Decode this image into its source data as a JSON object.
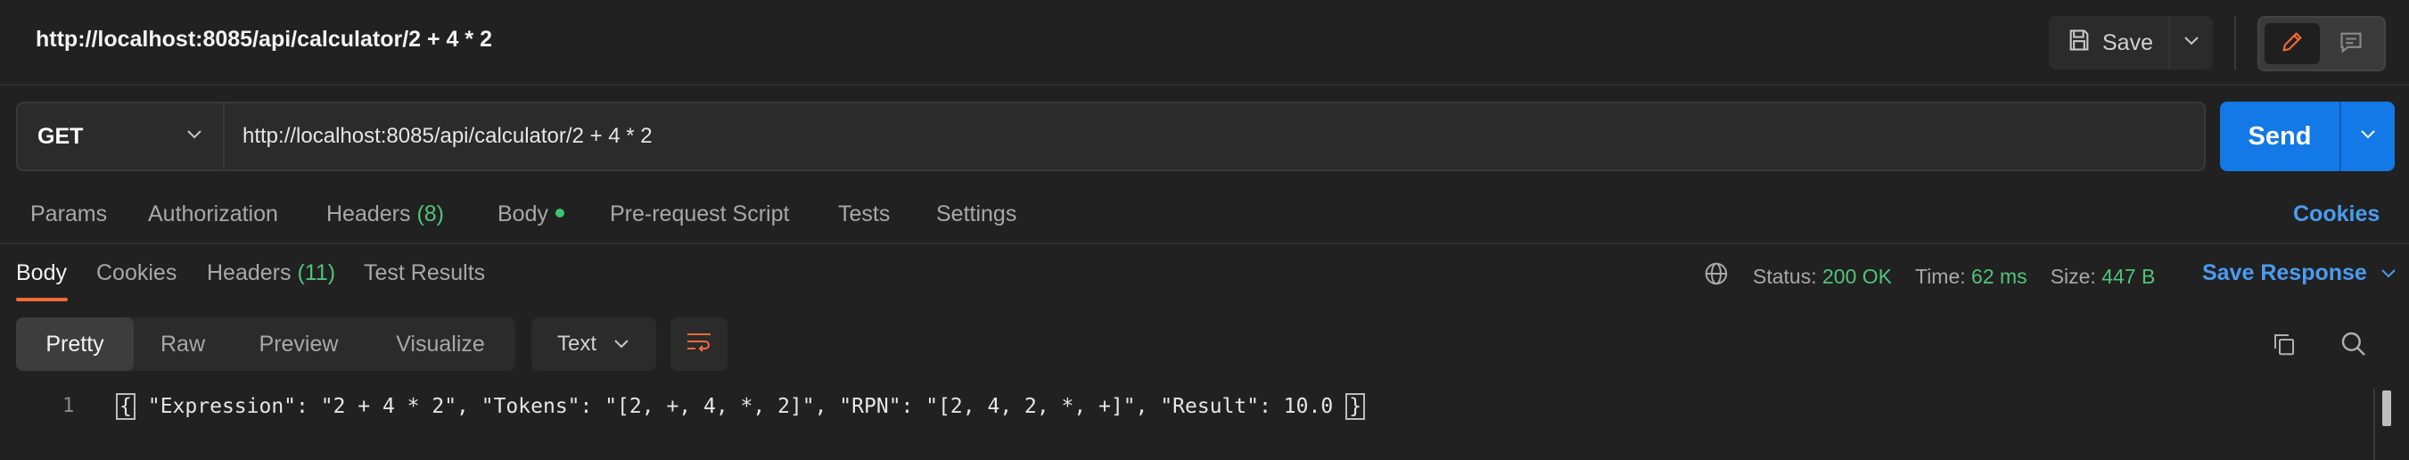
{
  "header": {
    "title": "http://localhost:8085/api/calculator/2 + 4 * 2",
    "save_label": "Save"
  },
  "request": {
    "method": "GET",
    "url": "http://localhost:8085/api/calculator/2 + 4 * 2",
    "send_label": "Send"
  },
  "request_tabs": {
    "params": "Params",
    "authorization": "Authorization",
    "headers": "Headers",
    "headers_count": "(8)",
    "body": "Body",
    "pre_request": "Pre-request Script",
    "tests": "Tests",
    "settings": "Settings",
    "cookies": "Cookies"
  },
  "response_tabs": {
    "body": "Body",
    "cookies": "Cookies",
    "headers": "Headers",
    "headers_count": "(11)",
    "test_results": "Test Results"
  },
  "status": {
    "status_label": "Status:",
    "status_value": "200 OK",
    "time_label": "Time:",
    "time_value": "62 ms",
    "size_label": "Size:",
    "size_value": "447 B",
    "save_response": "Save Response"
  },
  "view_modes": {
    "pretty": "Pretty",
    "raw": "Raw",
    "preview": "Preview",
    "visualize": "Visualize",
    "format": "Text"
  },
  "code": {
    "line_number": "1",
    "text": "\"Expression\": \"2 + 4 * 2\", \"Tokens\": \"[2, +, 4, *, 2]\", \"RPN\": \"[2, 4, 2, *, +]\", \"Result\": 10.0"
  },
  "colors": {
    "background": "#212121",
    "accent_send": "#1379e6",
    "link_blue": "#4a9cf0",
    "status_green": "#4fc47a",
    "tab_underline": "#f26b3a"
  },
  "icons": [
    "save-icon",
    "chevron-down-icon",
    "pencil-icon",
    "comment-icon",
    "globe-icon",
    "wrap-lines-icon",
    "copy-icon",
    "search-icon"
  ]
}
